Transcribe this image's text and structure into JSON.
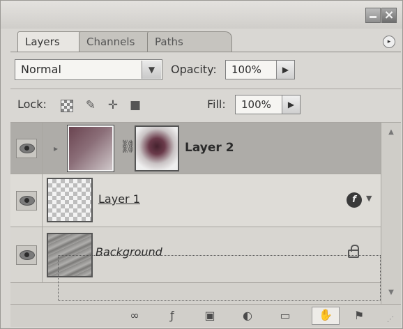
{
  "tabs": {
    "layers": "Layers",
    "channels": "Channels",
    "paths": "Paths"
  },
  "panel_menu_icon": "▸",
  "window": {
    "close_glyph": "×"
  },
  "blend": {
    "mode": "Normal",
    "opacity_label": "Opacity:",
    "opacity_value": "100%",
    "dropdown_glyph": "▼",
    "arrow_glyph": "▶"
  },
  "lock": {
    "label": "Lock:",
    "fill_label": "Fill:",
    "fill_value": "100%",
    "brush_glyph": "✎",
    "move_glyph": "✛",
    "all_glyph": "■"
  },
  "layers": [
    {
      "name": "Layer 2",
      "selected": true,
      "has_mask": true
    },
    {
      "name": "Layer 1",
      "has_effects": true,
      "fx_glyph": "f",
      "expand_glyph": "▼"
    },
    {
      "name": "Background",
      "locked": true
    }
  ],
  "scroll": {
    "up_glyph": "▲",
    "down_glyph": "▼"
  },
  "toolbar": {
    "link": "∞",
    "fx": "ƒ",
    "mask": "▣",
    "adjust": "◐",
    "group": "▭",
    "new_layer": "✋",
    "delete": "⚑",
    "grip": "⋰"
  },
  "colors": {
    "panel_bg": "#d9d7d3",
    "selected_row": "#aeaca8"
  }
}
